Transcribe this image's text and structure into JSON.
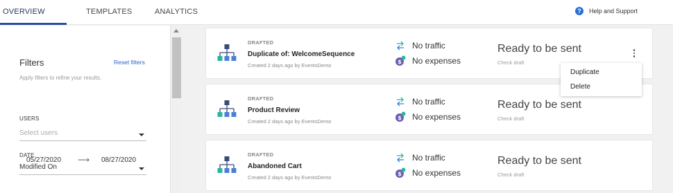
{
  "nav": {
    "tabs": [
      {
        "label": "OVERVIEW",
        "active": true
      },
      {
        "label": "TEMPLATES",
        "active": false
      },
      {
        "label": "ANALYTICS",
        "active": false
      }
    ],
    "help": {
      "label": "Help and Support",
      "icon": "question-circle-icon"
    }
  },
  "sidebar": {
    "title": "Filters",
    "reset_label": "Reset filters",
    "subtitle": "Apply filters to refine your results.",
    "users": {
      "label": "USERS",
      "placeholder": "Select users"
    },
    "date": {
      "label": "DATE",
      "value": "Modified On",
      "from": "05/27/2020",
      "arrow": "⟶",
      "to": "08/27/2020"
    }
  },
  "cards": [
    {
      "status": "DRAFTED",
      "title": "Duplicate of: WelcomeSequence",
      "meta": "Created 2 days ago by EventsDemo",
      "traffic": "No traffic",
      "expenses": "No expenses",
      "state": "Ready to be sent",
      "action": "Check draft"
    },
    {
      "status": "DRAFTED",
      "title": "Product Review",
      "meta": "Created 2 days ago by EventsDemo",
      "traffic": "No traffic",
      "expenses": "No expenses",
      "state": "Ready to be sent",
      "action": "Check draft"
    },
    {
      "status": "DRAFTED",
      "title": "Abandoned Cart",
      "meta": "Created 2 days ago by EventsDemo",
      "traffic": "No traffic",
      "expenses": "No expenses",
      "state": "Ready to be sent",
      "action": "Check draft"
    }
  ],
  "menu": {
    "items": [
      "Duplicate",
      "Delete"
    ]
  },
  "colors": {
    "accent": "#2a4d9b",
    "link": "#2a5fc8",
    "flow_navy": "#3b4a7a",
    "flow_teal": "#2bb5a0",
    "flow_blue": "#4a7fd6",
    "traffic_green": "#2bb5a0",
    "expense_purple": "#6a5fb5"
  }
}
